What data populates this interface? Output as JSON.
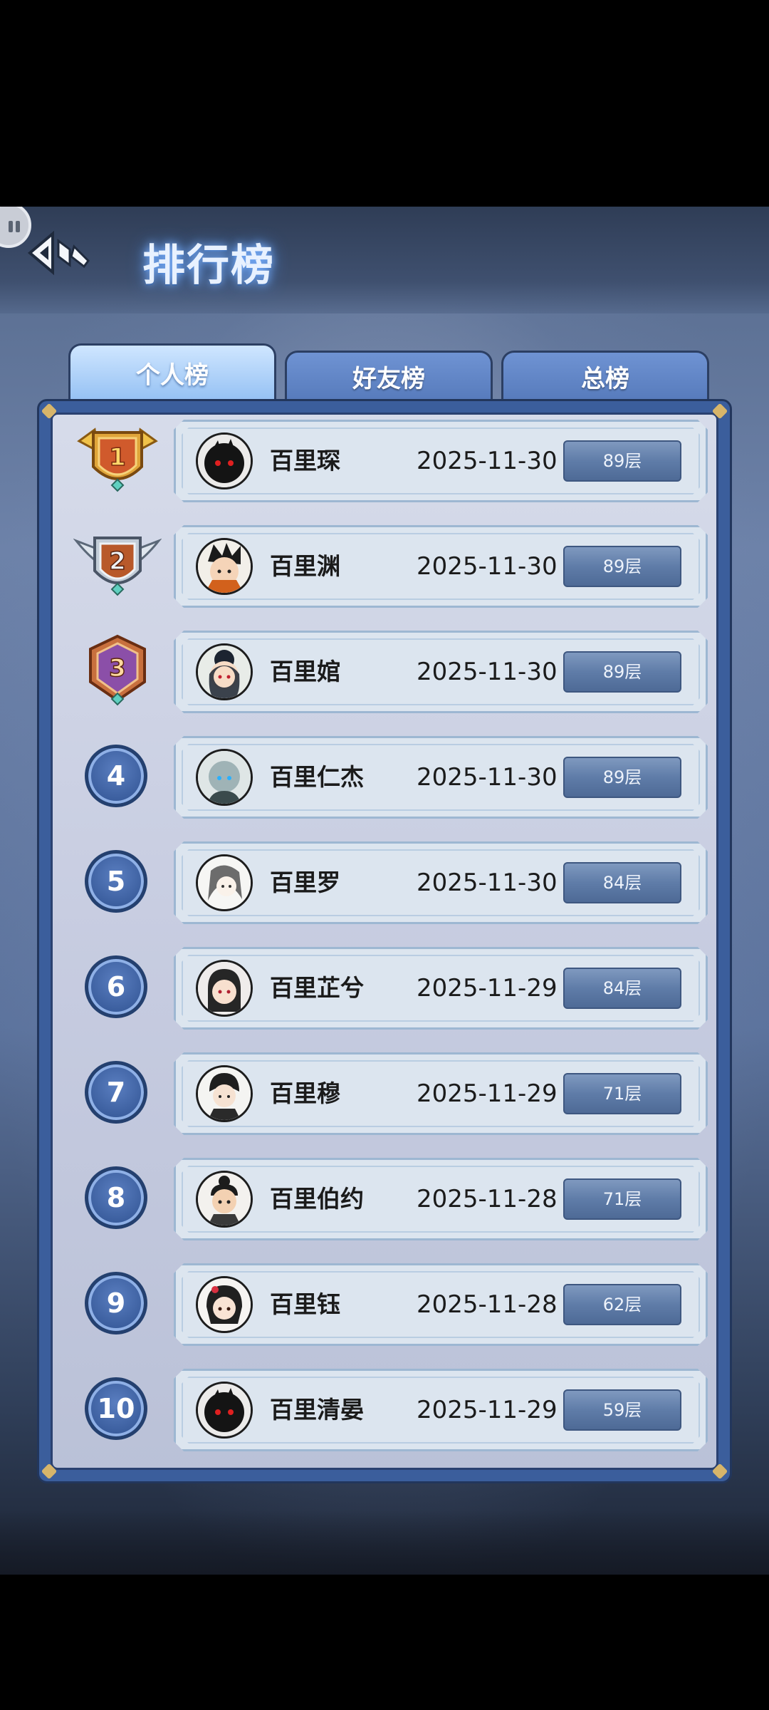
{
  "header": {
    "title": "排行榜",
    "pause_icon": "pause-icon",
    "back_icon": "back-arrow-icon"
  },
  "tabs": [
    {
      "label": "个人榜",
      "active": true
    },
    {
      "label": "好友榜",
      "active": false
    },
    {
      "label": "总榜",
      "active": false
    }
  ],
  "colors": {
    "active_tab": "#8fbdf2",
    "tab": "#5478b9",
    "panel_frame": "#3b5e9c",
    "card": "#dce5ef",
    "floor_badge": "#5f7ca8",
    "gold_medal": "#e0a53a",
    "silver_medal": "#c3cdd8",
    "bronze_medal": "#c8703e",
    "third_medal": "#8b4fa8"
  },
  "leaderboard": [
    {
      "rank": "1",
      "name": "百里琛",
      "date": "2025-11-30",
      "floor": "89层",
      "medal": "gold-medal-icon"
    },
    {
      "rank": "2",
      "name": "百里渊",
      "date": "2025-11-30",
      "floor": "89层",
      "medal": "silver-medal-icon"
    },
    {
      "rank": "3",
      "name": "百里婠",
      "date": "2025-11-30",
      "floor": "89层",
      "medal": "bronze-medal-icon"
    },
    {
      "rank": "4",
      "name": "百里仁杰",
      "date": "2025-11-30",
      "floor": "89层"
    },
    {
      "rank": "5",
      "name": "百里罗",
      "date": "2025-11-30",
      "floor": "84层"
    },
    {
      "rank": "6",
      "name": "百里芷兮",
      "date": "2025-11-29",
      "floor": "84层"
    },
    {
      "rank": "7",
      "name": "百里穆",
      "date": "2025-11-29",
      "floor": "71层"
    },
    {
      "rank": "8",
      "name": "百里伯约",
      "date": "2025-11-28",
      "floor": "71层"
    },
    {
      "rank": "9",
      "name": "百里钰",
      "date": "2025-11-28",
      "floor": "62层"
    },
    {
      "rank": "10",
      "name": "百里清晏",
      "date": "2025-11-29",
      "floor": "59层"
    }
  ]
}
